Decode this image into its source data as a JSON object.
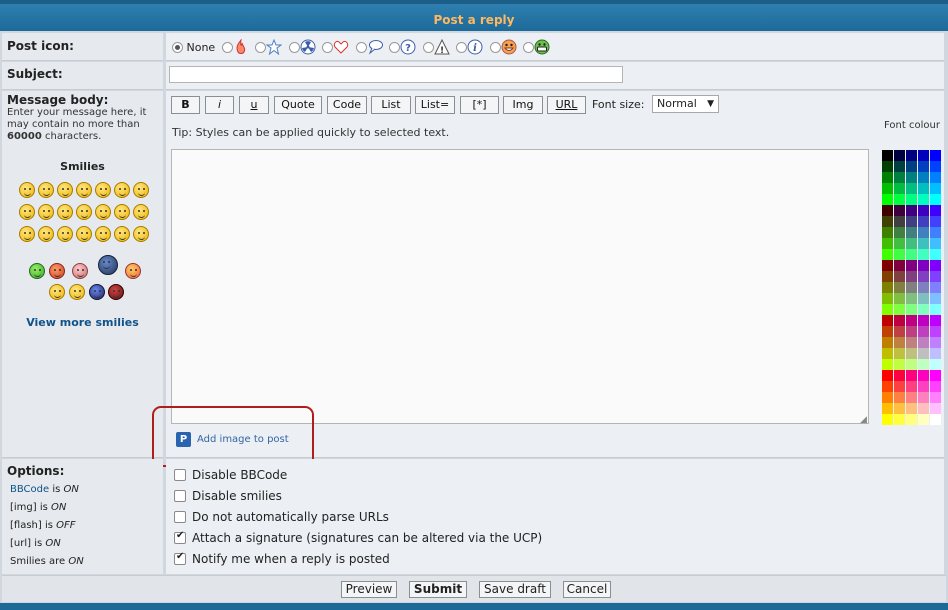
{
  "header": {
    "title": "Post a reply"
  },
  "post_icon": {
    "label": "Post icon:",
    "none_label": "None",
    "icons": [
      "fire-icon",
      "star-icon",
      "radioactive-icon",
      "heart-icon",
      "speech-bubble-icon",
      "question-icon",
      "warning-icon",
      "info-icon",
      "grin-face-icon",
      "teeth-face-icon"
    ]
  },
  "subject": {
    "label": "Subject:",
    "value": ""
  },
  "message": {
    "label": "Message body:",
    "hint_prefix": "Enter your message here, it may contain no more than",
    "hint_count": "60000",
    "hint_suffix": "characters.",
    "smilies_title": "Smilies",
    "view_more": "View more smilies",
    "tip": "Tip: Styles can be applied quickly to selected text.",
    "body": "",
    "add_image": "Add image to post"
  },
  "toolbar": {
    "bold": "B",
    "italic": "i",
    "underline": "u",
    "quote": "Quote",
    "code": "Code",
    "list": "List",
    "list_ordered": "List=",
    "list_item": "[*]",
    "img": "Img",
    "url": "URL",
    "font_size_label": "Font size:",
    "font_size_value": "Normal"
  },
  "colour": {
    "label": "Font colour"
  },
  "options": {
    "title": "Options:",
    "bbcode_link": "BBCode",
    "bbcode_is": "is",
    "bbcode_state": "ON",
    "img_tag": "[img]",
    "img_is": "is",
    "img_state": "ON",
    "flash_tag": "[flash]",
    "flash_is": "is",
    "flash_state": "OFF",
    "url_tag": "[url]",
    "url_is": "is",
    "url_state": "ON",
    "smilies_pre": "Smilies are",
    "smilies_state": "ON",
    "disable_bbcode": "Disable BBCode",
    "disable_smilies": "Disable smilies",
    "no_parse_urls": "Do not automatically parse URLs",
    "attach_signature": "Attach a signature (signatures can be altered via the UCP)",
    "notify_reply": "Notify me when a reply is posted"
  },
  "footer": {
    "preview": "Preview",
    "submit": "Submit",
    "save_draft": "Save draft",
    "cancel": "Cancel"
  }
}
